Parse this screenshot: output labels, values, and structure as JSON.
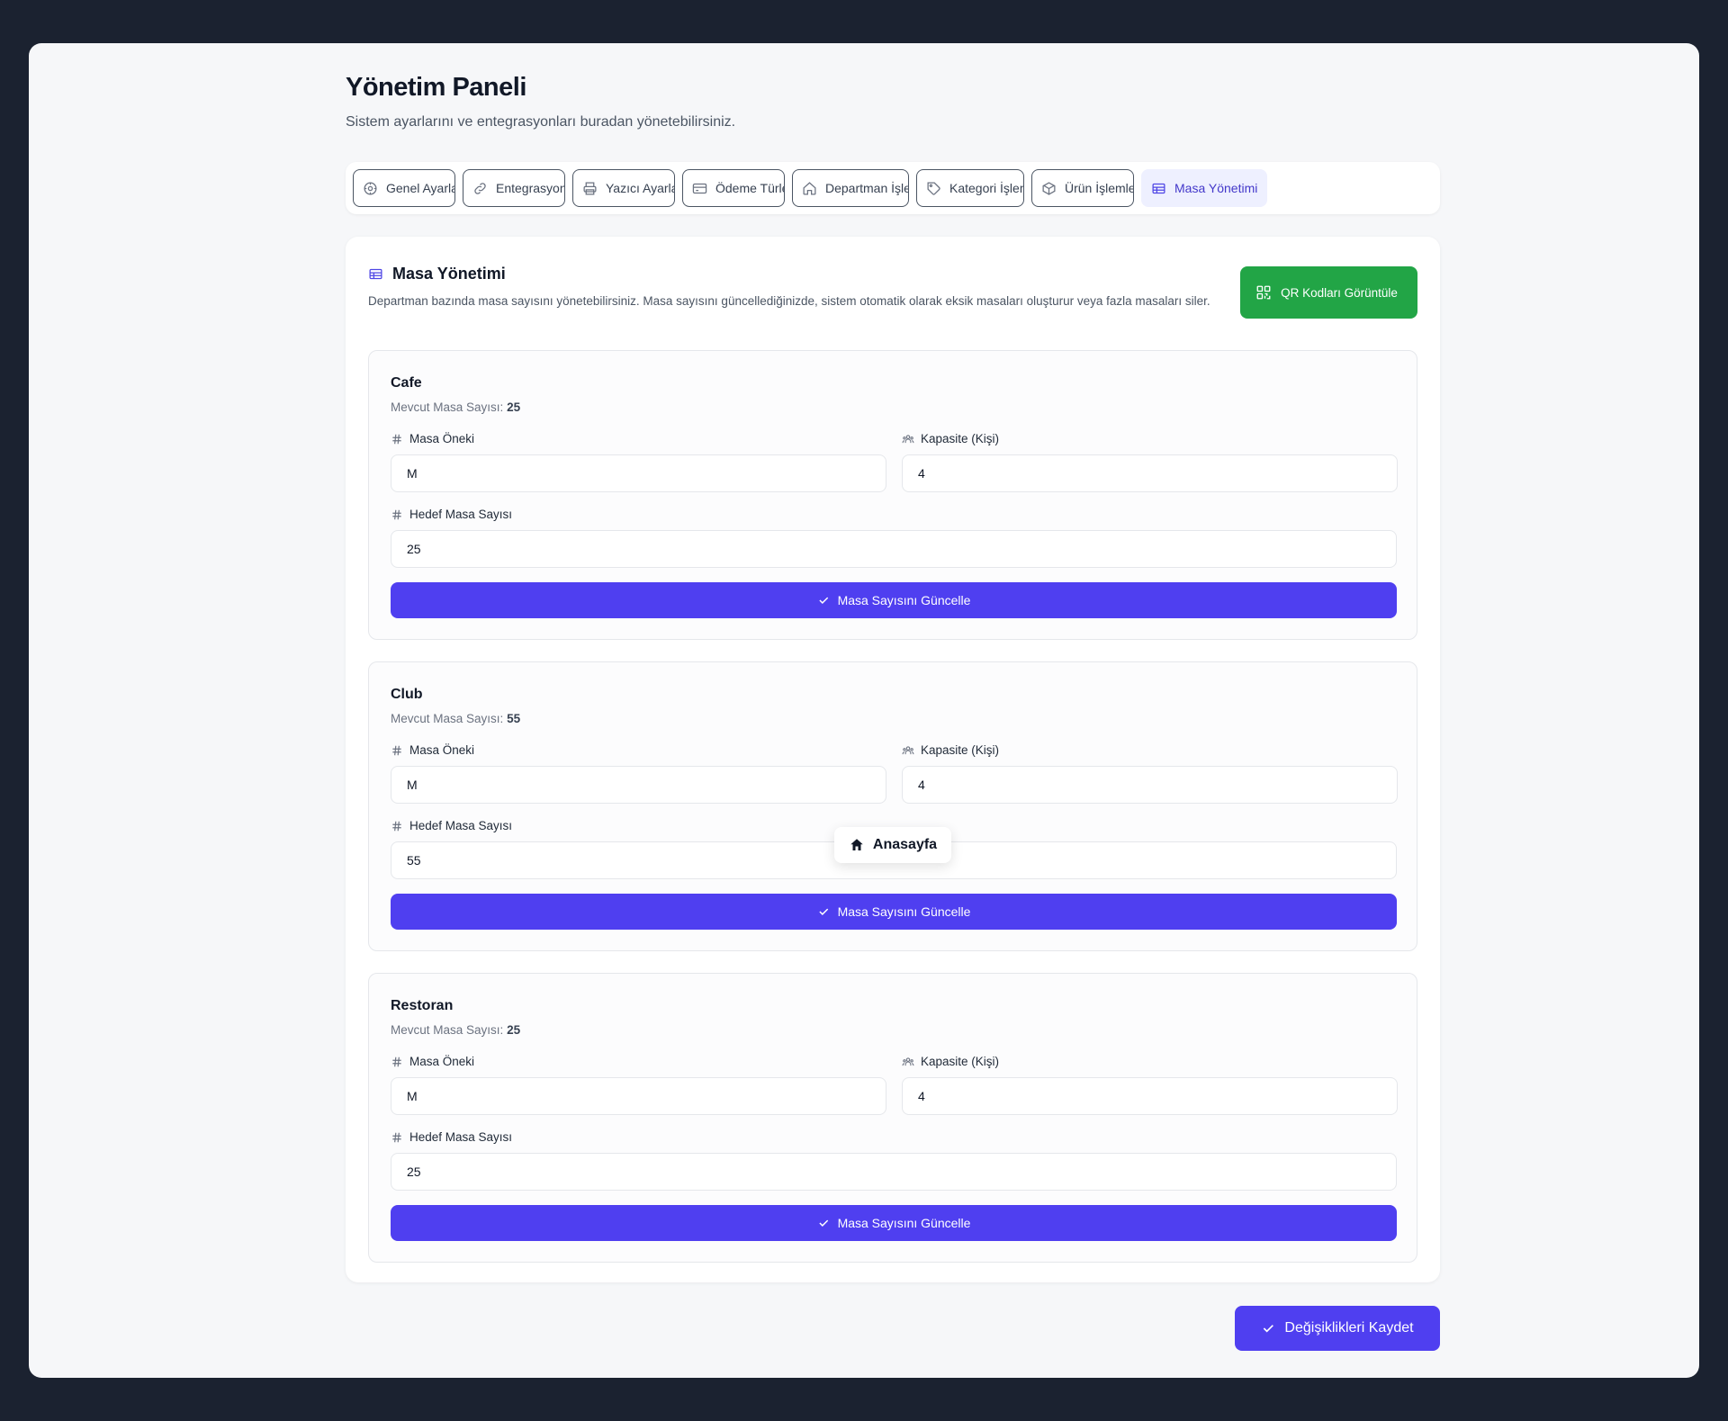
{
  "header": {
    "title": "Yönetim Paneli",
    "subtitle": "Sistem ayarlarını ve entegrasyonları buradan yönetebilirsiniz."
  },
  "tabs": [
    {
      "label": "Genel Ayarlar",
      "icon": "settings-icon"
    },
    {
      "label": "Entegrasyonlar",
      "icon": "link-icon"
    },
    {
      "label": "Yazıcı Ayarları",
      "icon": "printer-icon"
    },
    {
      "label": "Ödeme Türleri",
      "icon": "credit-card-icon"
    },
    {
      "label": "Departman İşlemleri",
      "icon": "home-icon"
    },
    {
      "label": "Kategori İşlemleri",
      "icon": "tag-icon"
    },
    {
      "label": "Ürün İşlemleri",
      "icon": "box-icon"
    },
    {
      "label": "Masa Yönetimi",
      "icon": "table-icon",
      "active": true
    }
  ],
  "section": {
    "title": "Masa Yönetimi",
    "description": "Departman bazında masa sayısını yönetebilirsiniz. Masa sayısını güncellediğinizde, sistem otomatik olarak eksik masaları oluşturur veya fazla masaları siler.",
    "qr_button": "QR Kodları Görüntüle"
  },
  "labels": {
    "current_count": "Mevcut Masa Sayısı:",
    "prefix": "Masa Öneki",
    "capacity": "Kapasite (Kişi)",
    "target": "Hedef Masa Sayısı",
    "update_button": "Masa Sayısını Güncelle"
  },
  "departments": [
    {
      "name": "Cafe",
      "current": "25",
      "prefix": "M",
      "capacity": "4",
      "target": "25"
    },
    {
      "name": "Club",
      "current": "55",
      "prefix": "M",
      "capacity": "4",
      "target": "55"
    },
    {
      "name": "Restoran",
      "current": "25",
      "prefix": "M",
      "capacity": "4",
      "target": "25"
    }
  ],
  "save_button": "Değişiklikleri Kaydet",
  "floating_nav": {
    "label": "Anasayfa",
    "icon": "home-icon"
  },
  "colors": {
    "accent": "#4f3ff0",
    "success": "#22a546",
    "background": "#1b2230",
    "panel": "#f6f7f9"
  }
}
